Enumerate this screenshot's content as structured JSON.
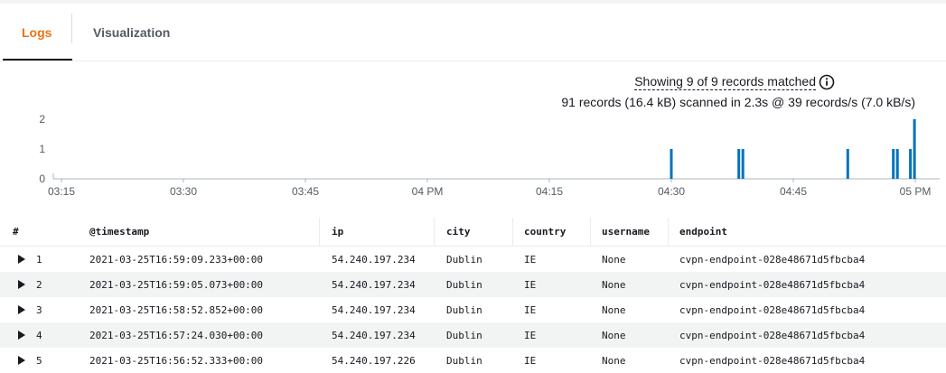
{
  "tabs": [
    {
      "label": "Logs",
      "active": true
    },
    {
      "label": "Visualization",
      "active": false
    }
  ],
  "summary": {
    "matched": "Showing 9 of 9 records matched",
    "scanned": "91 records (16.4 kB) scanned in 2.3s @ 39 records/s (7.0 kB/s)"
  },
  "chart_data": {
    "type": "bar",
    "title": "",
    "xlabel": "",
    "ylabel": "",
    "ylim": [
      0,
      2
    ],
    "yticks": [
      "0",
      "1",
      "2"
    ],
    "xticks": [
      "03:15",
      "03:30",
      "03:45",
      "04 PM",
      "04:15",
      "04:30",
      "04:45",
      "05 PM"
    ],
    "x_range_minutes": [
      -46,
      63
    ],
    "color": "#0073bb",
    "bars": [
      {
        "x": 30.0,
        "value": 1
      },
      {
        "x": 38.3,
        "value": 1
      },
      {
        "x": 38.8,
        "value": 1
      },
      {
        "x": 51.7,
        "value": 1
      },
      {
        "x": 57.3,
        "value": 1
      },
      {
        "x": 57.8,
        "value": 1
      },
      {
        "x": 59.4,
        "value": 1
      },
      {
        "x": 59.9,
        "value": 2
      }
    ]
  },
  "table": {
    "columns": [
      "#",
      "@timestamp",
      "ip",
      "city",
      "country",
      "username",
      "endpoint"
    ],
    "rows": [
      {
        "n": "1",
        "timestamp": "2021-03-25T16:59:09.233+00:00",
        "ip": "54.240.197.234",
        "city": "Dublin",
        "country": "IE",
        "username": "None",
        "endpoint": "cvpn-endpoint-028e48671d5fbcba4"
      },
      {
        "n": "2",
        "timestamp": "2021-03-25T16:59:05.073+00:00",
        "ip": "54.240.197.234",
        "city": "Dublin",
        "country": "IE",
        "username": "None",
        "endpoint": "cvpn-endpoint-028e48671d5fbcba4"
      },
      {
        "n": "3",
        "timestamp": "2021-03-25T16:58:52.852+00:00",
        "ip": "54.240.197.234",
        "city": "Dublin",
        "country": "IE",
        "username": "None",
        "endpoint": "cvpn-endpoint-028e48671d5fbcba4"
      },
      {
        "n": "4",
        "timestamp": "2021-03-25T16:57:24.030+00:00",
        "ip": "54.240.197.234",
        "city": "Dublin",
        "country": "IE",
        "username": "None",
        "endpoint": "cvpn-endpoint-028e48671d5fbcba4"
      },
      {
        "n": "5",
        "timestamp": "2021-03-25T16:56:52.333+00:00",
        "ip": "54.240.197.226",
        "city": "Dublin",
        "country": "IE",
        "username": "None",
        "endpoint": "cvpn-endpoint-028e48671d5fbcba4"
      }
    ]
  }
}
